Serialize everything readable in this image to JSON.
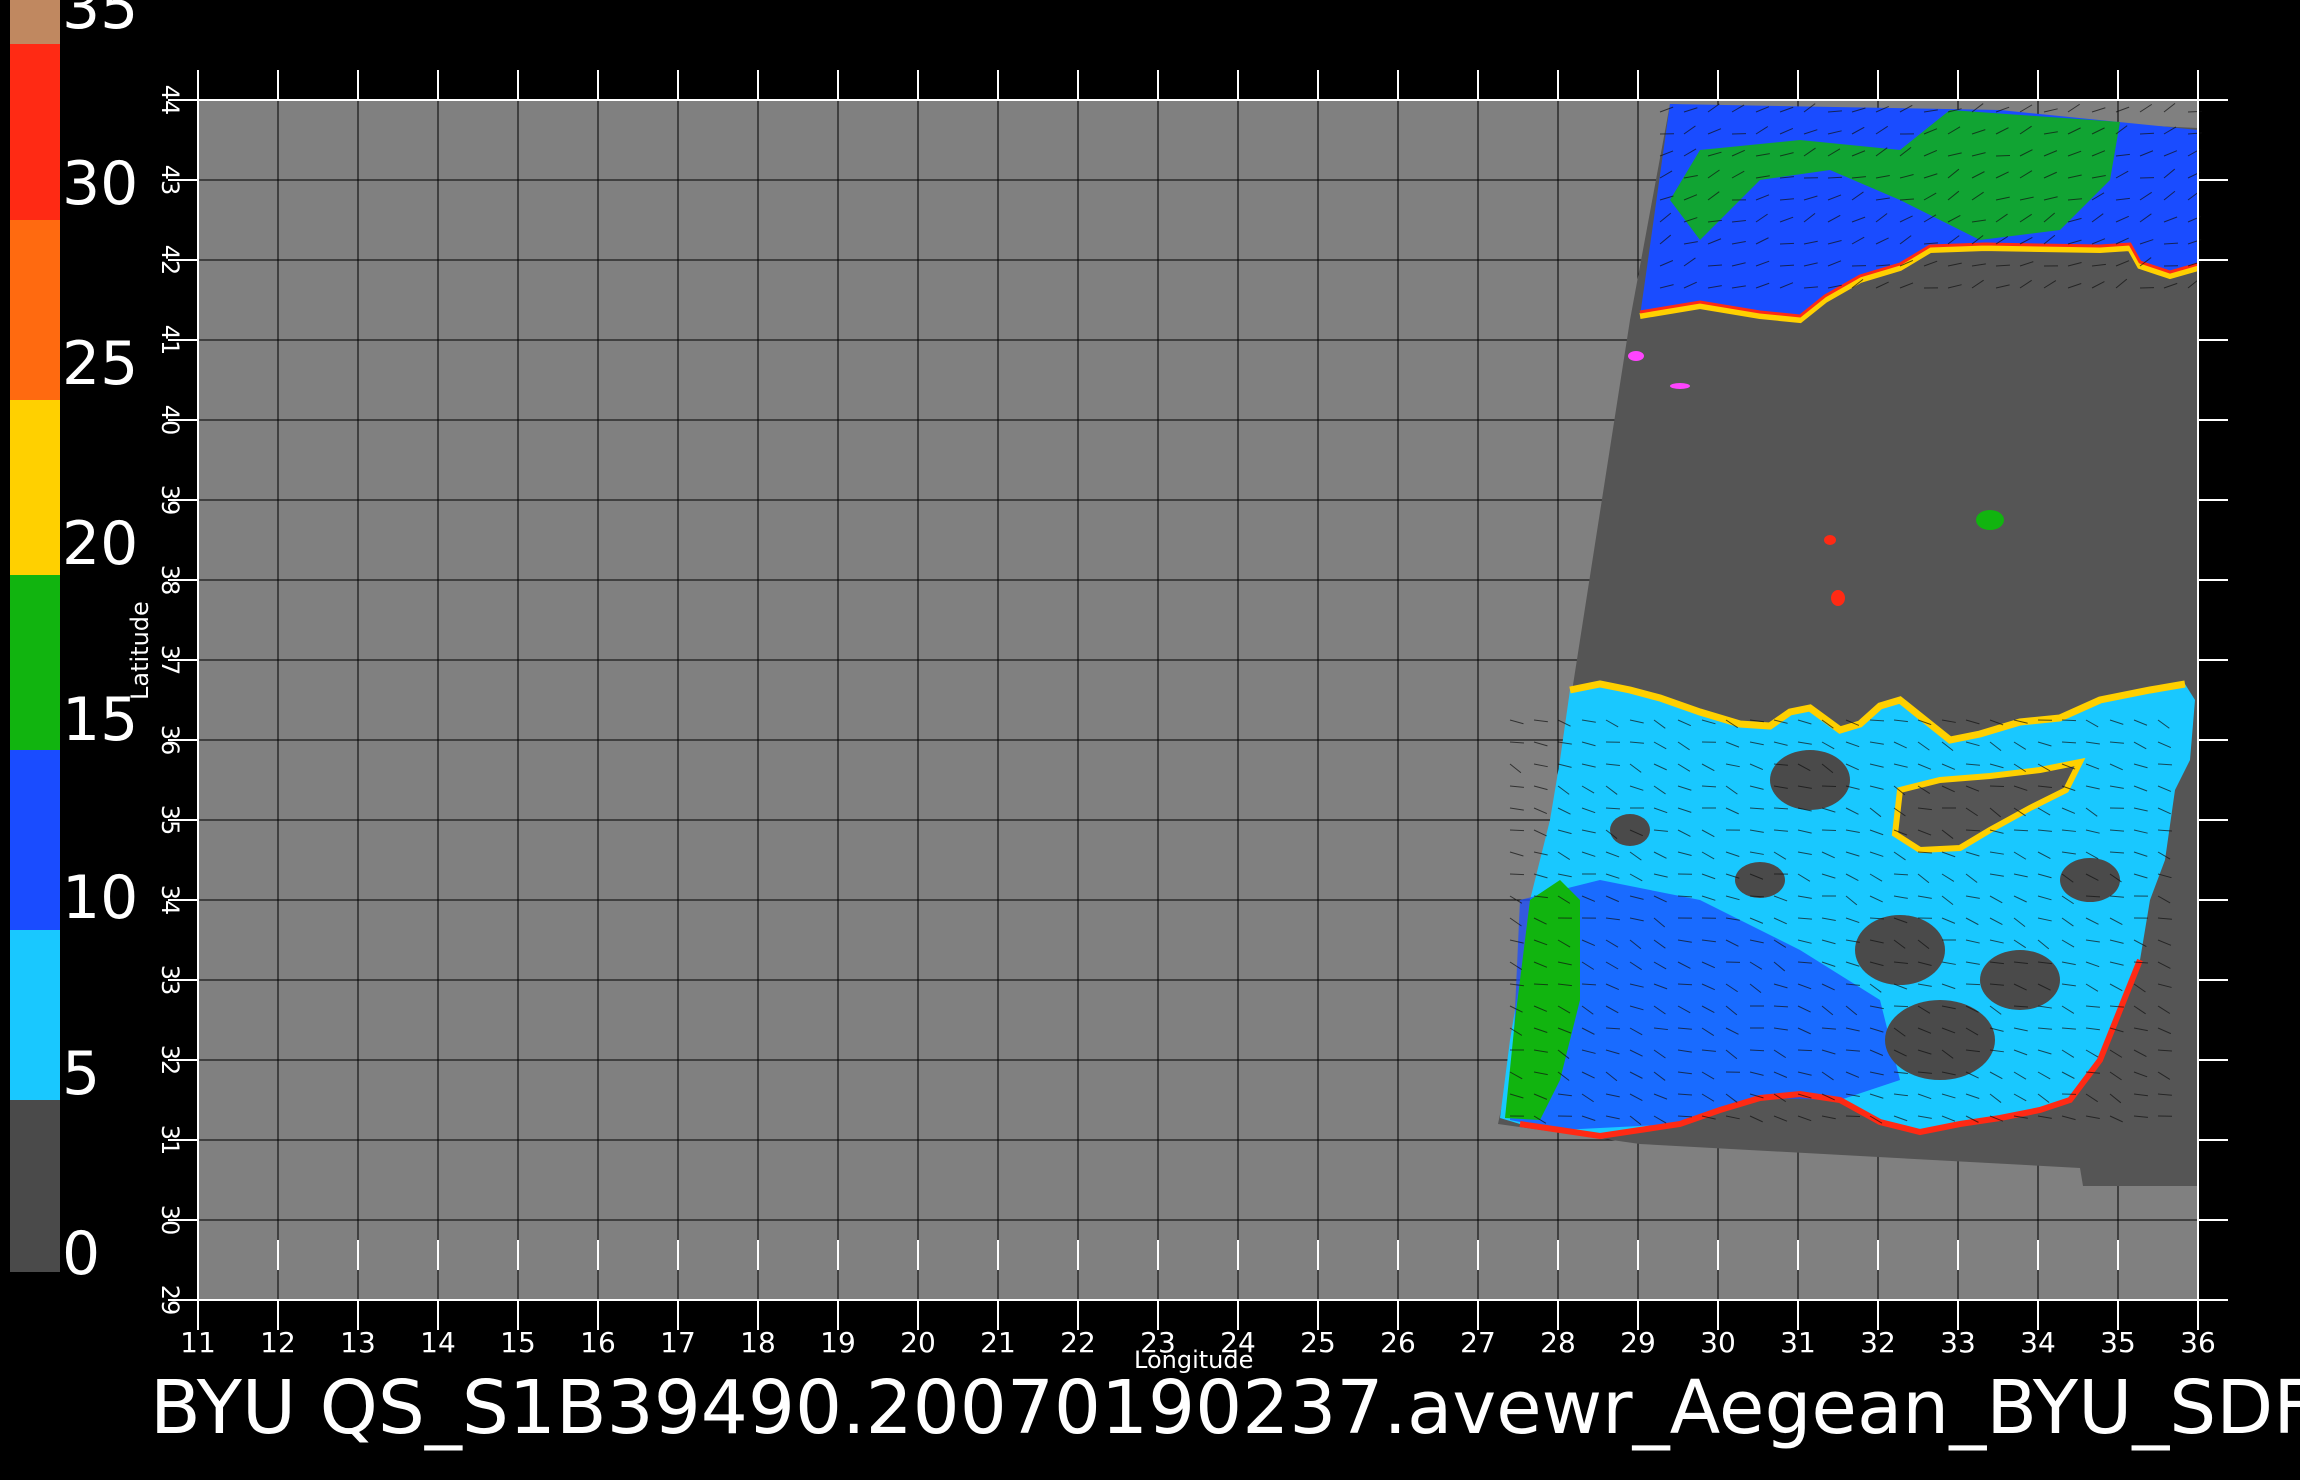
{
  "colorbar": {
    "labels": [
      "35",
      "30",
      "25",
      "20",
      "15",
      "10",
      "5",
      "0"
    ],
    "stops": [
      {
        "color": "#c08860"
      },
      {
        "color": "#ff2a14"
      },
      {
        "color": "#ff6a10"
      },
      {
        "color": "#ffd000"
      },
      {
        "color": "#11b40f"
      },
      {
        "color": "#1a4cff"
      },
      {
        "color": "#19c8ff"
      },
      {
        "color": "#4a4a4a"
      }
    ]
  },
  "axes": {
    "x_label": "Longitude",
    "y_label": "Latitude",
    "lon_ticks": [
      "11",
      "12",
      "13",
      "14",
      "15",
      "16",
      "17",
      "18",
      "19",
      "20",
      "21",
      "22",
      "23",
      "24",
      "25",
      "26",
      "27",
      "28",
      "29",
      "30",
      "31",
      "32",
      "33",
      "34",
      "35",
      "36"
    ],
    "lat_ticks": [
      "29",
      "30",
      "31",
      "32",
      "33",
      "34",
      "35",
      "36",
      "37",
      "38",
      "39",
      "40",
      "41",
      "42",
      "43",
      "44"
    ],
    "lon_range": [
      11,
      36
    ],
    "lat_range": [
      29,
      44
    ]
  },
  "colors": {
    "background": "#000000",
    "plot_bg": "#808080",
    "land": "#555555",
    "sea_low": "#19c8ff",
    "sea_mid": "#1a4cff",
    "sea_high": "#11b40f",
    "grid": "#000000"
  },
  "caption": "BYU  QS_S1B39490.20070190237.avewr_Aegean_BYU_SDF"
}
